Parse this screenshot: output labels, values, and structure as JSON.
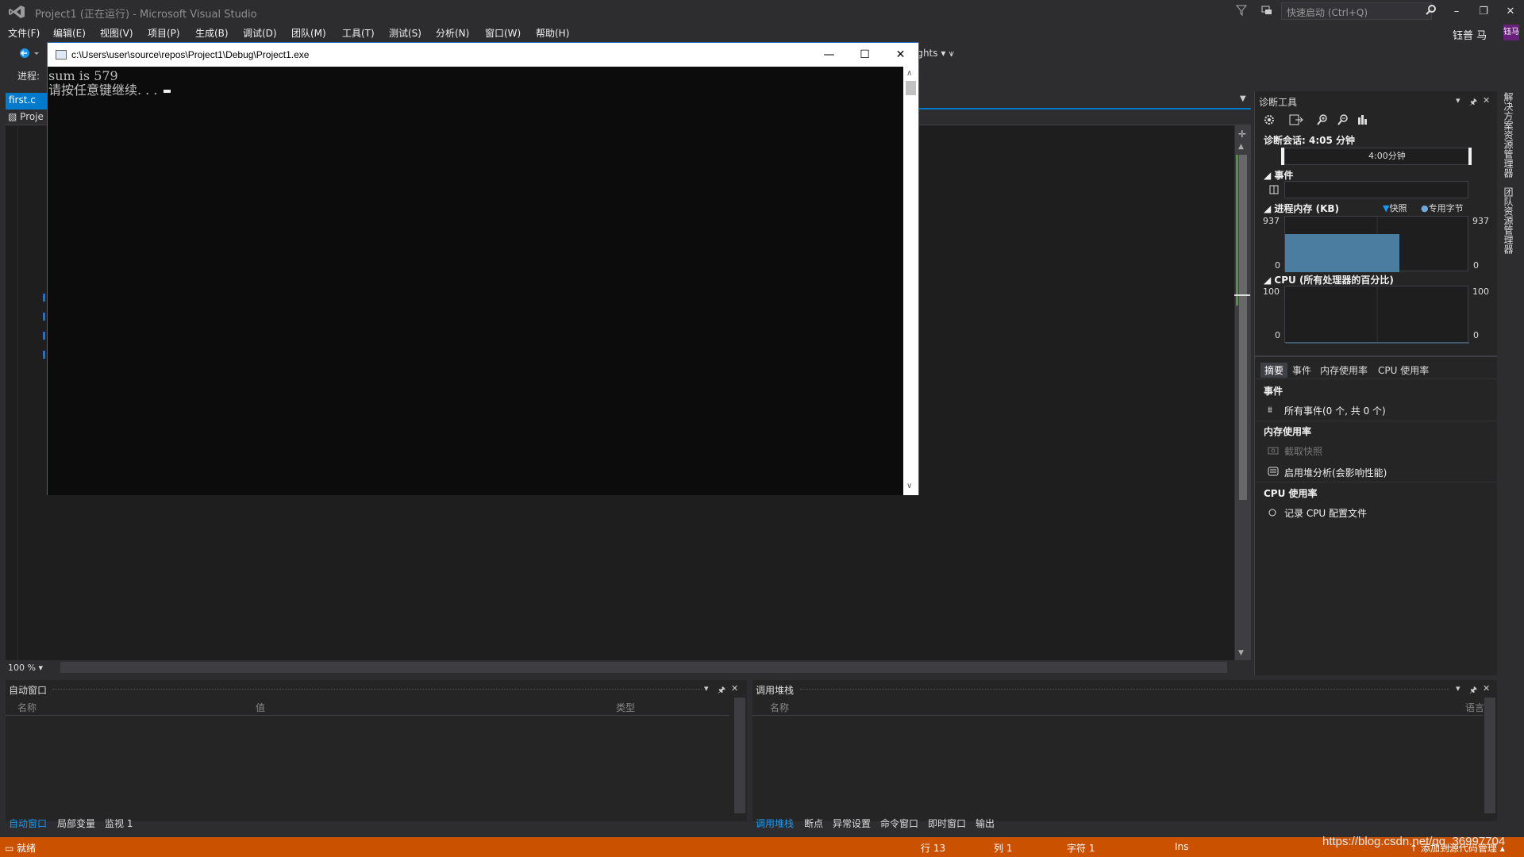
{
  "window": {
    "title": "Project1 (正在运行) - Microsoft Visual Studio",
    "quick_launch_placeholder": "快速启动 (Ctrl+Q)",
    "user_name": "钰普 马",
    "user_initials": "钰马"
  },
  "menu": [
    "文件(F)",
    "编辑(E)",
    "视图(V)",
    "项目(P)",
    "生成(B)",
    "调试(D)",
    "团队(M)",
    "工具(T)",
    "测试(S)",
    "分析(N)",
    "窗口(W)",
    "帮助(H)"
  ],
  "toolbar": {
    "insights_label": "ights",
    "progress_label": "进程:"
  },
  "editor": {
    "tab_label": "first.c",
    "nav_project": "Proje",
    "zoom": "100 %"
  },
  "console": {
    "path": "c:\\Users\\user\\source\\repos\\Project1\\Debug\\Project1.exe",
    "line1": "sum is 579",
    "line2": "请按任意键继续. . ."
  },
  "diagnostics": {
    "header": "诊断工具",
    "session": "诊断会话: 4:05 分钟",
    "timeline_label": "4:00分钟",
    "events_title": "事件",
    "memory_title": "进程内存 (KB)",
    "legend_snapshot": "快照",
    "legend_private": "专用字节",
    "mem_max": "937",
    "mem_min": "0",
    "cpu_title": "CPU (所有处理器的百分比)",
    "cpu_max": "100",
    "cpu_min": "0",
    "tabs": [
      "摘要",
      "事件",
      "内存使用率",
      "CPU 使用率"
    ],
    "summary_events_title": "事件",
    "all_events": "所有事件(0 个, 共 0 个)",
    "memory_usage_title": "内存使用率",
    "take_snapshot": "截取快照",
    "heap_analysis": "启用堆分析(会影响性能)",
    "cpu_usage_title": "CPU 使用率",
    "record_cpu": "记录 CPU 配置文件"
  },
  "memory_chart": {
    "filled_fraction_of_width": 0.62,
    "level_fraction": 0.68,
    "fill_color": "#4a7da0"
  },
  "vertical_tabs": [
    "解决方案资源管理器",
    "团队资源管理器"
  ],
  "autos_panel": {
    "title": "自动窗口",
    "col_name": "名称",
    "col_value": "值",
    "col_type": "类型",
    "tabs": [
      "自动窗口",
      "局部变量",
      "监视 1"
    ]
  },
  "callstack_panel": {
    "title": "调用堆栈",
    "col_name": "名称",
    "col_lang": "语言",
    "tabs": [
      "调用堆栈",
      "断点",
      "异常设置",
      "命令窗口",
      "即时窗口",
      "输出"
    ]
  },
  "status": {
    "ready": "就绪",
    "line": "行 13",
    "col": "列 1",
    "char": "字符 1",
    "ins": "Ins",
    "add_source": "添加到源代码管理",
    "watermark": "https://blog.csdn.net/qq_36997704"
  },
  "colors": {
    "accent": "#007acc",
    "statusbar": "#ca5100",
    "background": "#2d2d30"
  }
}
